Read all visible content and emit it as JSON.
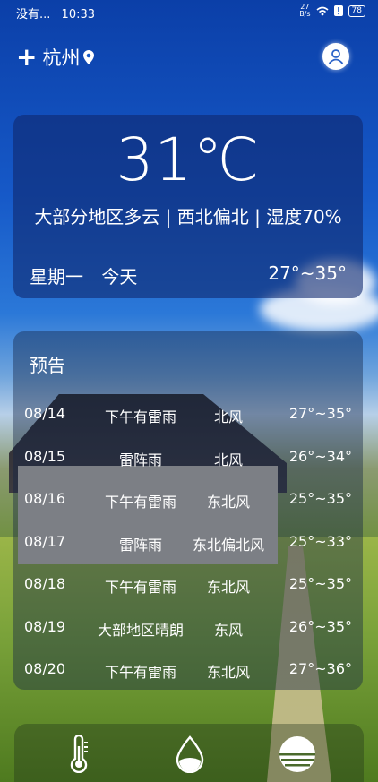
{
  "status": {
    "carrier": "没有...",
    "time": "10:33",
    "speed_value": "27",
    "speed_unit": "B/s",
    "battery": "78"
  },
  "header": {
    "city": "杭州"
  },
  "current": {
    "temperature": "31℃",
    "condition": "大部分地区多云 | 西北偏北 | 湿度70%",
    "weekday": "星期一",
    "today": "今天",
    "range": "27°~35°"
  },
  "forecast": {
    "title": "预告",
    "rows": [
      {
        "date": "08/14",
        "desc": "下午有雷雨",
        "wind": "北风",
        "temp": "27°~35°"
      },
      {
        "date": "08/15",
        "desc": "雷阵雨",
        "wind": "北风",
        "temp": "26°~34°"
      },
      {
        "date": "08/16",
        "desc": "下午有雷雨",
        "wind": "东北风",
        "temp": "25°~35°"
      },
      {
        "date": "08/17",
        "desc": "雷阵雨",
        "wind": "东北偏北风",
        "temp": "25°~33°"
      },
      {
        "date": "08/18",
        "desc": "下午有雷雨",
        "wind": "东北风",
        "temp": "25°~35°"
      },
      {
        "date": "08/19",
        "desc": "大部地区晴朗",
        "wind": "东风",
        "temp": "26°~35°"
      },
      {
        "date": "08/20",
        "desc": "下午有雷雨",
        "wind": "东北风",
        "temp": "27°~36°"
      }
    ]
  },
  "nav": {
    "icons": [
      "thermometer-icon",
      "water-drop-icon",
      "sunset-icon"
    ]
  }
}
